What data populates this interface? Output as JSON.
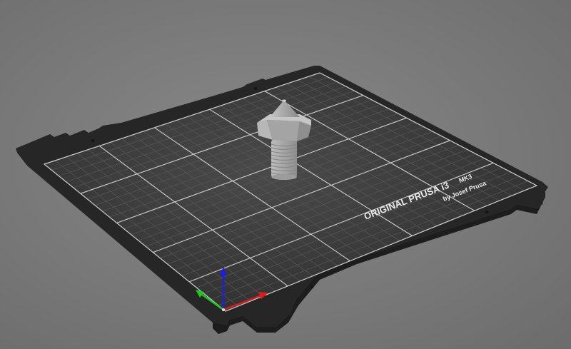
{
  "bed": {
    "brand_line": "ORIGINAL PRUSA i3",
    "model": "MK3",
    "maker": "by Josef Prusa"
  },
  "colors": {
    "background": "#7a7a7a",
    "bed_frame": "#2e2e2e",
    "bed_surface": "#3a3a3a",
    "grid_minor": "#5a5a5a",
    "grid_major": "#cfcfcf",
    "model": "#a9a9a9",
    "axis_x": "#d81e1e",
    "axis_y": "#1ec81e",
    "axis_z": "#1e1ee0"
  },
  "grid": {
    "major_divisions": 5,
    "minor_per_major": 5
  },
  "icons": {
    "axes": "xyz-axes-icon",
    "model": "nozzle-model-icon"
  }
}
